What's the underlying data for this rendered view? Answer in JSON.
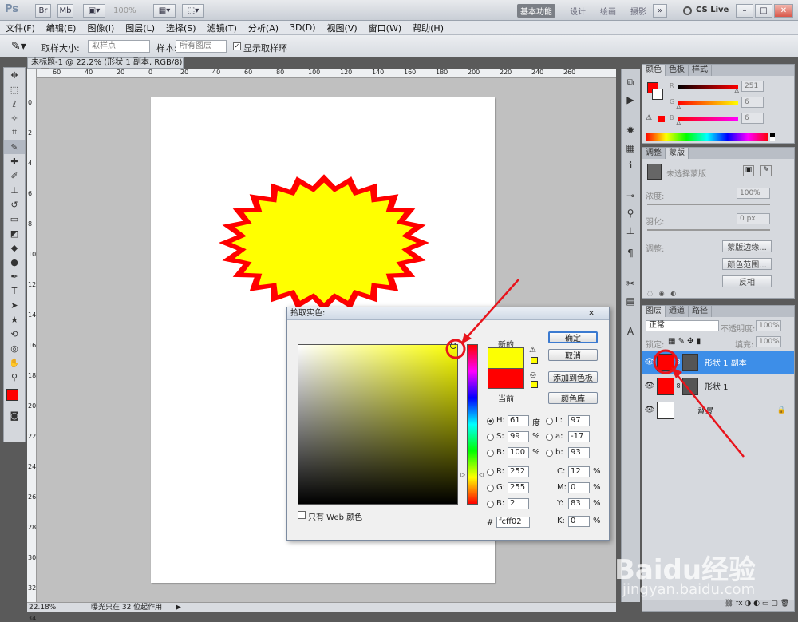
{
  "titlebar": {
    "app_logo": "Ps",
    "zoom": "100%",
    "workspaces": [
      "基本功能",
      "设计",
      "绘画",
      "摄影"
    ],
    "more": "»",
    "cs_live": "CS Live",
    "window_buttons": [
      "–",
      "□",
      "✕"
    ]
  },
  "menubar": [
    "文件(F)",
    "编辑(E)",
    "图像(I)",
    "图层(L)",
    "选择(S)",
    "滤镜(T)",
    "分析(A)",
    "3D(D)",
    "视图(V)",
    "窗口(W)",
    "帮助(H)"
  ],
  "options": {
    "sample_size_label": "取样大小:",
    "sample_size_value": "取样点",
    "sample_label": "样本:",
    "sample_value": "所有图层",
    "show_ring_label": "显示取样环"
  },
  "document": {
    "tab_title": "未标题-1 @ 22.2% (形状 1 副本, RGB/8) *",
    "ruler_top": [
      "60",
      "40",
      "20",
      "0",
      "20",
      "40",
      "60",
      "80",
      "100",
      "120",
      "140",
      "160",
      "180",
      "200",
      "220",
      "240",
      "260"
    ],
    "ruler_left": [
      "0",
      "2",
      "4",
      "6",
      "8",
      "10",
      "12",
      "14",
      "16",
      "18",
      "20",
      "22",
      "24",
      "26",
      "28",
      "30",
      "32",
      "34"
    ],
    "status_zoom": "22.18%",
    "status_text": "曝光只在 32 位起作用"
  },
  "color_panel": {
    "tabs": [
      "颜色",
      "色板",
      "样式"
    ],
    "r_label": "R",
    "g_label": "G",
    "b_label": "B",
    "r": "251",
    "g": "6",
    "b": "6",
    "r_frac": 0.98,
    "g_frac": 0.02,
    "b_frac": 0.02
  },
  "adjust_panel": {
    "tabs": [
      "调整",
      "蒙版"
    ],
    "mask_label": "未选择蒙版",
    "density_label": "浓度:",
    "density_value": "100%",
    "feather_label": "羽化:",
    "feather_value": "0 px",
    "refine_label": "调整:",
    "mask_edge_btn": "蒙版边缘...",
    "color_range_btn": "颜色范围...",
    "invert_btn": "反相"
  },
  "layers_panel": {
    "tabs": [
      "图层",
      "通道",
      "路径"
    ],
    "blend_mode": "正常",
    "opacity_label": "不透明度:",
    "opacity_value": "100%",
    "lock_label": "锁定:",
    "fill_label": "填充:",
    "fill_value": "100%",
    "layers": [
      {
        "name": "形状 1 副本",
        "selected": true,
        "thumb": "#ff0000"
      },
      {
        "name": "形状 1",
        "selected": false,
        "thumb": "#ff0000"
      },
      {
        "name": "背景",
        "selected": false,
        "thumb": "#ffffff"
      }
    ],
    "footer_icons": [
      "link-icon",
      "fx-icon",
      "mask-icon",
      "adjustment-icon",
      "folder-icon",
      "new-layer-icon",
      "trash-icon"
    ]
  },
  "dialog": {
    "title": "拾取实色:",
    "new_label": "新的",
    "current_label": "当前",
    "new_color": "#fcff02",
    "current_color": "#ff0000",
    "ok": "确定",
    "cancel": "取消",
    "add_swatch": "添加到色板",
    "color_lib": "颜色库",
    "h_label": "H:",
    "h": "61",
    "h_unit": "度",
    "s_label": "S:",
    "s": "99",
    "s_unit": "%",
    "bv_label": "B:",
    "bv": "100",
    "bv_unit": "%",
    "r_label": "R:",
    "r": "252",
    "g_label": "G:",
    "g": "255",
    "b_label": "B:",
    "b": "2",
    "l_label": "L:",
    "l": "97",
    "a_label": "a:",
    "a": "-17",
    "lb_label": "b:",
    "lb": "93",
    "c_label": "C:",
    "c": "12",
    "c_unit": "%",
    "m_label": "M:",
    "m": "0",
    "m_unit": "%",
    "y_label": "Y:",
    "y": "83",
    "y_unit": "%",
    "k_label": "K:",
    "k": "0",
    "k_unit": "%",
    "hex_label": "#",
    "hex": "fcff02",
    "web_only_label": "只有 Web 颜色"
  },
  "watermark": {
    "text": "Baidu经验",
    "url": "jingyan.baidu.com"
  },
  "colors": {
    "star_red": "#ff0000",
    "star_yellow": "#ffff00",
    "annotation_red": "#e8141c",
    "selected_layer": "#3d8ee8"
  }
}
